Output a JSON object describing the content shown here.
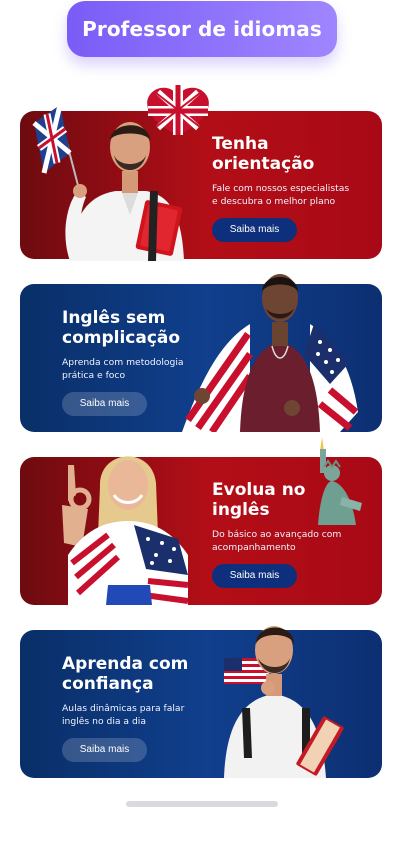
{
  "header": {
    "title": "Professor de idiomas"
  },
  "cards": [
    {
      "title_line1": "Tenha",
      "title_line2": "orientação",
      "desc_line1": "Fale com nossos especialistas",
      "desc_line2": "e descubra o melhor plano",
      "button": "Saiba mais"
    },
    {
      "title_line1": "Inglês sem",
      "title_line2": "complicação",
      "desc_line1": "Aprenda com metodologia",
      "desc_line2": "prática e foco",
      "button": "Saiba mais"
    },
    {
      "title_line1": "Evolua no",
      "title_line2": "inglês",
      "desc_line1": "Do básico ao avançado com",
      "desc_line2": "acompanhamento",
      "button": "Saiba mais"
    },
    {
      "title_line1": "Aprenda com",
      "title_line2": "confiança",
      "desc_line1": "Aulas dinâmicas para falar",
      "desc_line2": "inglês no dia a dia",
      "button": "Saiba mais"
    }
  ],
  "colors": {
    "header_start": "#7a5cf6",
    "header_end": "#9f86ff",
    "card_red": "#b30e17",
    "card_blue": "#103f8d",
    "button_dark_blue": "#0d2f7c"
  },
  "icons": [
    "union-jack-flag-icon",
    "heart-balloon-icon",
    "usa-flag-icon",
    "statue-of-liberty-icon",
    "book-icon"
  ]
}
